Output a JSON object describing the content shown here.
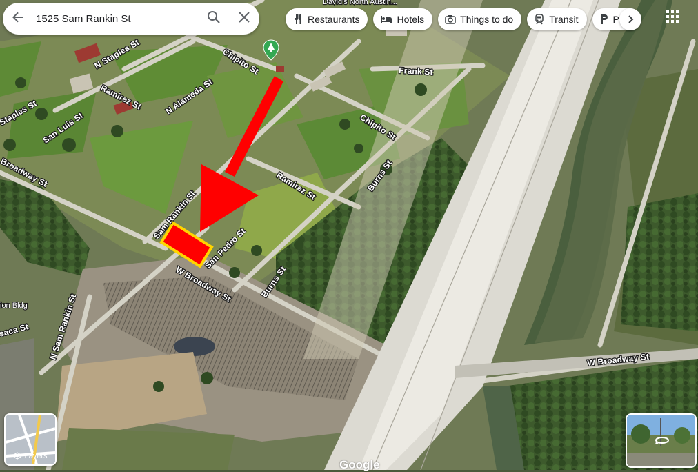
{
  "search": {
    "value": "1525 Sam Rankin St"
  },
  "icons": {
    "back": "arrow-left-icon",
    "search": "search-icon",
    "clear": "close-icon",
    "apps": "apps-grid-icon",
    "layers": "layers-icon",
    "rotate": "rotate-360-icon",
    "next": "chevron-right-icon"
  },
  "chips": [
    {
      "label": "Restaurants",
      "icon": "fork-knife-icon"
    },
    {
      "label": "Hotels",
      "icon": "bed-icon"
    },
    {
      "label": "Things to do",
      "icon": "camera-icon"
    },
    {
      "label": "Transit",
      "icon": "train-icon"
    },
    {
      "label": "Par",
      "icon": "parking-icon"
    }
  ],
  "map": {
    "poi_top": "David's North Austin...",
    "poi_bldg": "ion Bldg",
    "streets": {
      "n_staples": "N Staples St",
      "chipito_1": "Chipito St",
      "chipito_2": "Chipito St",
      "frank": "Frank St",
      "ramirez_1": "Ramirez St",
      "ramirez_2": "Ramirez St",
      "n_alameda": "N Alameda St",
      "staples": "Staples St",
      "san_luis": "San Luis St",
      "broadway_nw": "Broadway St",
      "burns_1": "Burns St",
      "burns_2": "Burns St",
      "sam_rankin": "Sam Rankin St",
      "san_pedro": "San Pedro St",
      "w_broadway_1": "W Broadway St",
      "w_broadway_2": "W Broadway St",
      "n_sam_rankin": "N Sam Rankin St",
      "saca": "saca St"
    },
    "colors": {
      "highlight_fill": "#ff0000",
      "highlight_stroke": "#ffd400",
      "arrow": "#ff0000"
    }
  },
  "layers": {
    "label": "Layers"
  },
  "logo": "Google"
}
